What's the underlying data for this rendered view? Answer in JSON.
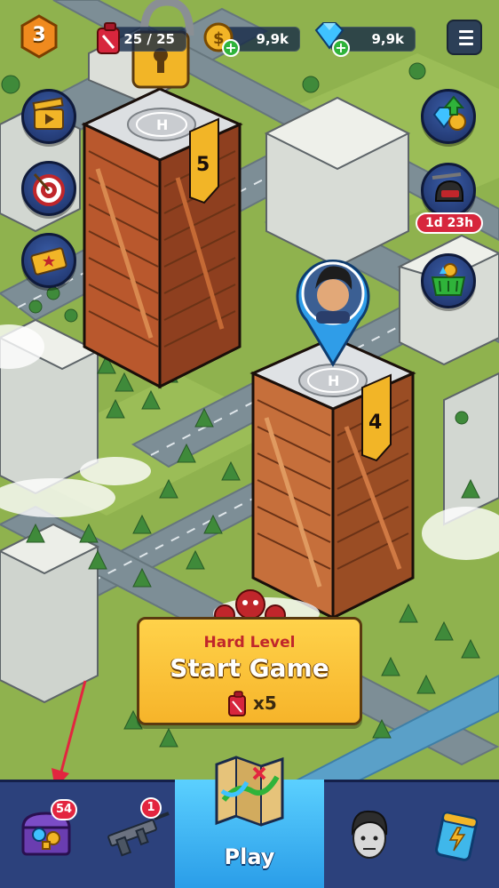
{
  "hud": {
    "level": "3",
    "energy": "25 / 25",
    "coins": "9,9k",
    "gems": "9,9k"
  },
  "buildings": [
    {
      "number": "5",
      "helipad": "H",
      "locked": true
    },
    {
      "number": "4",
      "helipad": "H",
      "locked": false
    }
  ],
  "side_buttons": {
    "timer": "1d 23h"
  },
  "start_panel": {
    "difficulty": "Hard Level",
    "title": "Start Game",
    "cost": "x5"
  },
  "bottom_nav": {
    "chest_badge": "54",
    "weapon_badge": "1",
    "play_label": "Play"
  },
  "colors": {
    "grass": "#8fb24e",
    "road": "#7d8e96",
    "panel_yellow": "#ffd24a",
    "nav_blue": "#2c417c",
    "play_blue": "#2a9de8",
    "badge_red": "#e3253f"
  }
}
